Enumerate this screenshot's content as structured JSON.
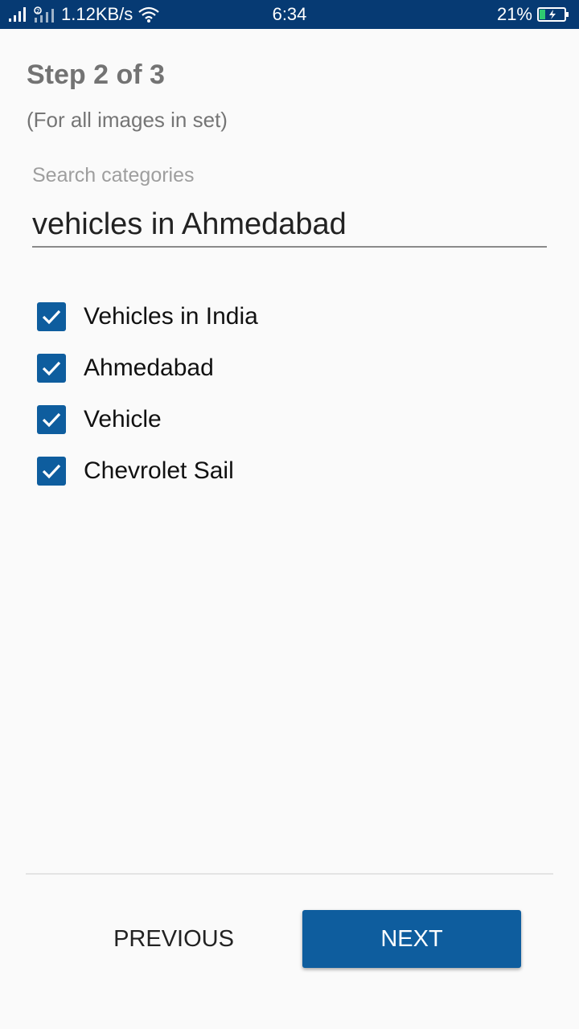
{
  "status_bar": {
    "network_speed": "1.12KB/s",
    "time": "6:34",
    "battery_percent": "21%",
    "icons": [
      "signal-icon",
      "sim2-signal-icon",
      "wifi-icon",
      "battery-charging-icon"
    ]
  },
  "step": {
    "title": "Step 2 of 3",
    "subtitle": "(For all images in set)"
  },
  "search": {
    "label": "Search categories",
    "value": "vehicles in Ahmedabad"
  },
  "categories": [
    {
      "label": "Vehicles in India",
      "checked": true
    },
    {
      "label": "Ahmedabad",
      "checked": true
    },
    {
      "label": "Vehicle",
      "checked": true
    },
    {
      "label": "Chevrolet Sail",
      "checked": true
    }
  ],
  "buttons": {
    "previous": "PREVIOUS",
    "next": "NEXT"
  },
  "colors": {
    "status_bar": "#063a73",
    "accent": "#0e5d9e",
    "background": "#fafafa"
  }
}
